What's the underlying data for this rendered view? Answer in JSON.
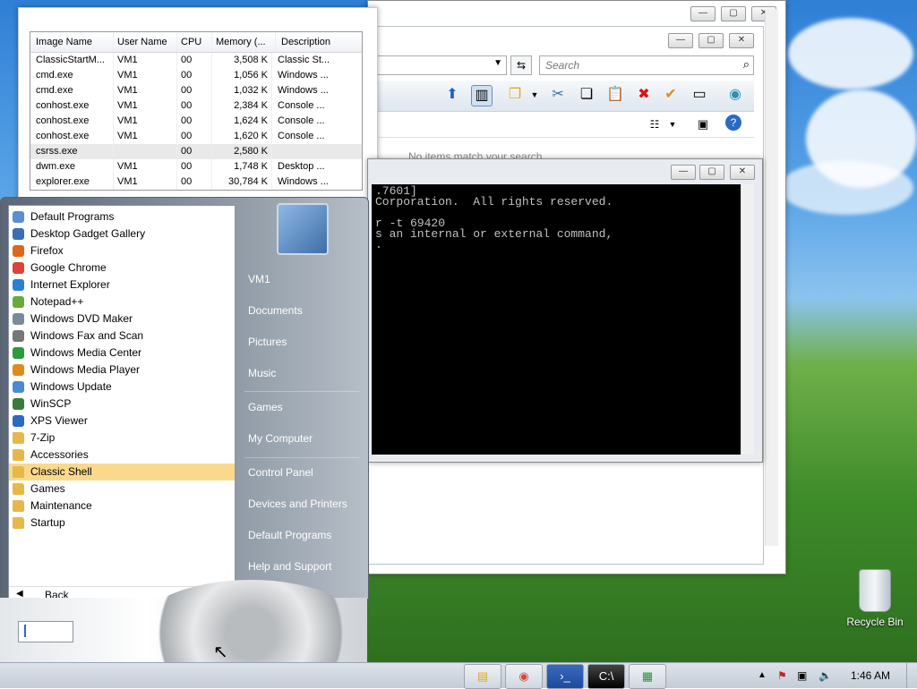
{
  "taskmgr": {
    "columns": [
      "Image Name",
      "User Name",
      "CPU",
      "Memory (...",
      "Description"
    ],
    "rows": [
      [
        "ClassicStartM...",
        "VM1",
        "00",
        "3,508 K",
        "Classic St..."
      ],
      [
        "cmd.exe",
        "VM1",
        "00",
        "1,056 K",
        "Windows ..."
      ],
      [
        "cmd.exe",
        "VM1",
        "00",
        "1,032 K",
        "Windows ..."
      ],
      [
        "conhost.exe",
        "VM1",
        "00",
        "2,384 K",
        "Console ..."
      ],
      [
        "conhost.exe",
        "VM1",
        "00",
        "1,624 K",
        "Console ..."
      ],
      [
        "conhost.exe",
        "VM1",
        "00",
        "1,620 K",
        "Console ..."
      ],
      [
        "csrss.exe",
        "",
        "00",
        "2,580 K",
        ""
      ],
      [
        "dwm.exe",
        "VM1",
        "00",
        "1,748 K",
        "Desktop ..."
      ],
      [
        "explorer.exe",
        "VM1",
        "00",
        "30,784 K",
        "Windows ..."
      ]
    ]
  },
  "explorer": {
    "search_placeholder": "Search",
    "empty_text": "No items match your search."
  },
  "cmd": {
    "lines": [
      ".7601]",
      "Corporation.  All rights reserved.",
      "",
      "r -t 69420",
      "s an internal or external command,",
      "."
    ]
  },
  "startmenu": {
    "programs": [
      {
        "label": "Default Programs",
        "icon": "default-programs-icon",
        "color": "#5a8fd0"
      },
      {
        "label": "Desktop Gadget Gallery",
        "icon": "gadget-gallery-icon",
        "color": "#3b6fb0"
      },
      {
        "label": "Firefox",
        "icon": "firefox-icon",
        "color": "#e0661c"
      },
      {
        "label": "Google Chrome",
        "icon": "chrome-icon",
        "color": "#db4437"
      },
      {
        "label": "Internet Explorer",
        "icon": "internet-explorer-icon",
        "color": "#2a7fd4"
      },
      {
        "label": "Notepad++",
        "icon": "notepadpp-icon",
        "color": "#6aaa3a"
      },
      {
        "label": "Windows DVD Maker",
        "icon": "dvd-maker-icon",
        "color": "#7b8a99"
      },
      {
        "label": "Windows Fax and Scan",
        "icon": "fax-scan-icon",
        "color": "#777"
      },
      {
        "label": "Windows Media Center",
        "icon": "media-center-icon",
        "color": "#2f9a3c"
      },
      {
        "label": "Windows Media Player",
        "icon": "media-player-icon",
        "color": "#e08a1c"
      },
      {
        "label": "Windows Update",
        "icon": "windows-update-icon",
        "color": "#4a8ad0"
      },
      {
        "label": "WinSCP",
        "icon": "winscp-icon",
        "color": "#3a7a3a"
      },
      {
        "label": "XPS Viewer",
        "icon": "xps-viewer-icon",
        "color": "#2a6ac0"
      },
      {
        "label": "7-Zip",
        "icon": "folder-icon",
        "color": "#e6b84a",
        "folder": true
      },
      {
        "label": "Accessories",
        "icon": "folder-icon",
        "color": "#e6b84a",
        "folder": true
      },
      {
        "label": "Classic Shell",
        "icon": "folder-icon",
        "color": "#e6b84a",
        "folder": true,
        "highlight": true
      },
      {
        "label": "Games",
        "icon": "folder-icon",
        "color": "#e6b84a",
        "folder": true
      },
      {
        "label": "Maintenance",
        "icon": "folder-icon",
        "color": "#e6b84a",
        "folder": true
      },
      {
        "label": "Startup",
        "icon": "folder-icon",
        "color": "#e6b84a",
        "folder": true
      }
    ],
    "back_label": "Back",
    "right": [
      "VM1",
      "Documents",
      "Pictures",
      "Music",
      "Games",
      "My Computer",
      "Control Panel",
      "Devices and Printers",
      "Default Programs",
      "Help and Support"
    ]
  },
  "desktop": {
    "recycle_bin": "Recycle Bin"
  },
  "taskbar": {
    "clock": "1:46 AM"
  }
}
